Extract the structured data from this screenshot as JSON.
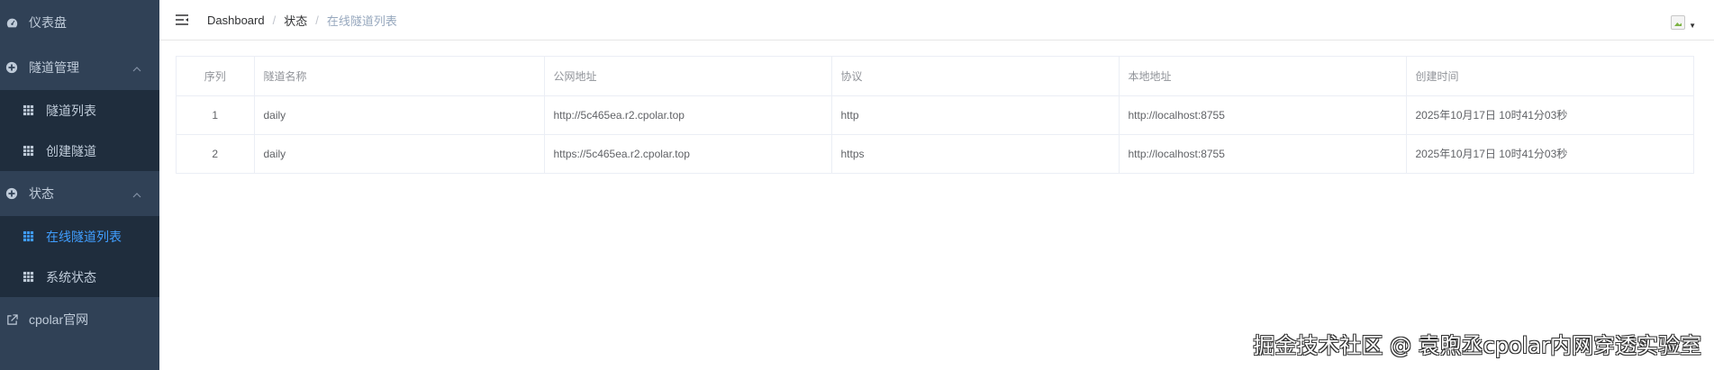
{
  "sidebar": {
    "dashboard": "仪表盘",
    "tunnel_manage": "隧道管理",
    "tunnel_list": "隧道列表",
    "create_tunnel": "创建隧道",
    "status": "状态",
    "online_tunnels": "在线隧道列表",
    "system_status": "系统状态",
    "official_site": "cpolar官网"
  },
  "breadcrumb": [
    "Dashboard",
    "状态",
    "在线隧道列表"
  ],
  "table": {
    "headers": [
      "序列",
      "隧道名称",
      "公网地址",
      "协议",
      "本地地址",
      "创建时间"
    ],
    "rows": [
      [
        "1",
        "daily",
        "http://5c465ea.r2.cpolar.top",
        "http",
        "http://localhost:8755",
        "2025年10月17日 10时41分03秒"
      ],
      [
        "2",
        "daily",
        "https://5c465ea.r2.cpolar.top",
        "https",
        "http://localhost:8755",
        "2025年10月17日 10时41分03秒"
      ]
    ]
  },
  "watermark": "掘金技术社区 @ 袁煦丞cpolar内网穿透实验室",
  "colors": {
    "sidebar_bg": "#304156",
    "submenu_bg": "#1f2d3d",
    "active": "#409eff"
  }
}
